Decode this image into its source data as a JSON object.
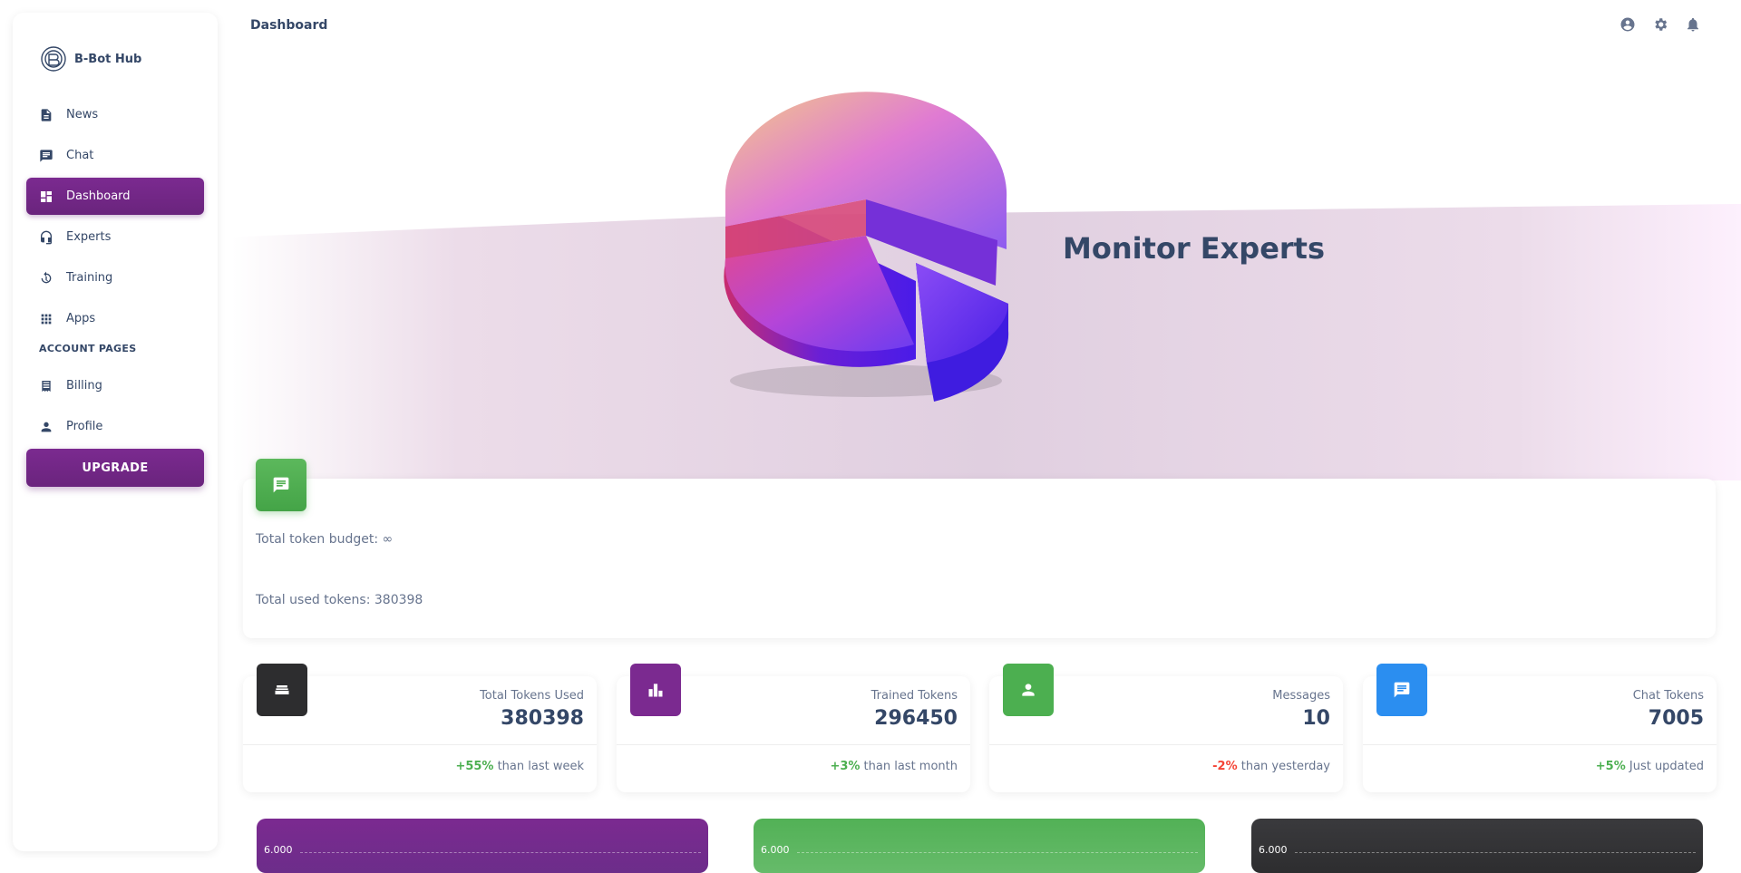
{
  "brand": {
    "name": "B-Bot Hub"
  },
  "sidebar": {
    "items": [
      {
        "label": "News",
        "icon": "news-icon"
      },
      {
        "label": "Chat",
        "icon": "chat-icon"
      },
      {
        "label": "Dashboard",
        "icon": "dashboard-icon",
        "active": true
      },
      {
        "label": "Experts",
        "icon": "experts-icon"
      },
      {
        "label": "Training",
        "icon": "training-icon"
      },
      {
        "label": "Apps",
        "icon": "apps-icon"
      }
    ],
    "section_title": "ACCOUNT PAGES",
    "account_items": [
      {
        "label": "Billing",
        "icon": "billing-icon"
      },
      {
        "label": "Profile",
        "icon": "profile-icon"
      }
    ],
    "upgrade_label": "UPGRADE"
  },
  "header": {
    "title": "Dashboard",
    "icons": [
      "account-icon",
      "settings-icon",
      "notifications-icon"
    ]
  },
  "hero": {
    "title": "Monitor Experts"
  },
  "budget": {
    "total_budget": "Total token budget: ∞",
    "total_used": "Total used tokens: 380398"
  },
  "stats": [
    {
      "label": "Total Tokens Used",
      "value": "380398",
      "change": "+55%",
      "change_text": " than last week",
      "trend": "up",
      "color": "#2d2d2f",
      "icon": "sofa-icon"
    },
    {
      "label": "Trained Tokens",
      "value": "296450",
      "change": "+3%",
      "change_text": " than last month",
      "trend": "up",
      "color": "#7b2a90",
      "icon": "leaderboard-icon"
    },
    {
      "label": "Messages",
      "value": "10",
      "change": "-2%",
      "change_text": " than yesterday",
      "trend": "down",
      "color": "#4caf50",
      "icon": "person-icon"
    },
    {
      "label": "Chat Tokens",
      "value": "7005",
      "change": "+5%",
      "change_text": " Just updated",
      "trend": "up",
      "color": "#2b8ef0",
      "icon": "chat-icon"
    }
  ],
  "charts": [
    {
      "tick": "6.000",
      "color": "#7b2a90"
    },
    {
      "tick": "6.000",
      "color": "#4caf50"
    },
    {
      "tick": "6.000",
      "color": "#2d2d2f"
    }
  ]
}
